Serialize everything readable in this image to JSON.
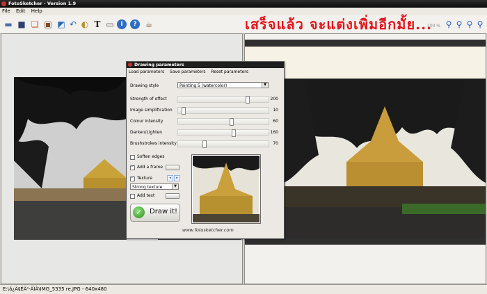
{
  "window": {
    "title": "FotoSketcher - Version 1.9"
  },
  "menu": [
    "File",
    "Edit",
    "Help"
  ],
  "toolbar": {
    "icons": [
      "open-folder-icon",
      "save-icon",
      "copy-icon",
      "export-icon",
      "image-icon",
      "undo-icon",
      "palette-icon",
      "text-tool-icon",
      "scanner-icon",
      "info-icon",
      "help-icon",
      "coffee-icon"
    ],
    "zoom_icons": [
      "zoom-in-icon",
      "zoom-out-icon",
      "zoom-fit-icon",
      "zoom-100-icon"
    ],
    "zoom_label": "100 %"
  },
  "overlay_text": "เสร็จแล้ว จะแต่งเพิ่มอีกมั้ย...",
  "dialog": {
    "title": "Drawing parameters",
    "menu": [
      "Load parameters",
      "Save parameters",
      "Reset parameters"
    ],
    "style_label": "Drawing style",
    "style_value": "Painting 5 (watercolor)",
    "sliders": [
      {
        "label": "Strength of effect",
        "value": "200",
        "fraction": 0.78
      },
      {
        "label": "Image simplification",
        "value": "10",
        "fraction": 0.04
      },
      {
        "label": "Colour intensity",
        "value": "60",
        "fraction": 0.6
      },
      {
        "label": "Darken/Lighten",
        "value": "160",
        "fraction": 0.62
      },
      {
        "label": "Brushstrokes intensity",
        "value": "70",
        "fraction": 0.28
      }
    ],
    "options": {
      "soften_edges": {
        "label": "Soften edges",
        "checked": false
      },
      "add_frame": {
        "label": "Add a frame",
        "checked": true
      },
      "texture": {
        "label": "Texture",
        "checked": true
      },
      "texture_value": "Strong texture",
      "add_text": {
        "label": "Add text",
        "checked": false
      }
    },
    "draw_button": "Draw it!",
    "website": "www.fotosketcher.com"
  },
  "status": {
    "text": "E:\\ã¿Ã§ÊÃ¹·ÃÏÂ\\IMG_5335 re.JPG - 640x480"
  }
}
